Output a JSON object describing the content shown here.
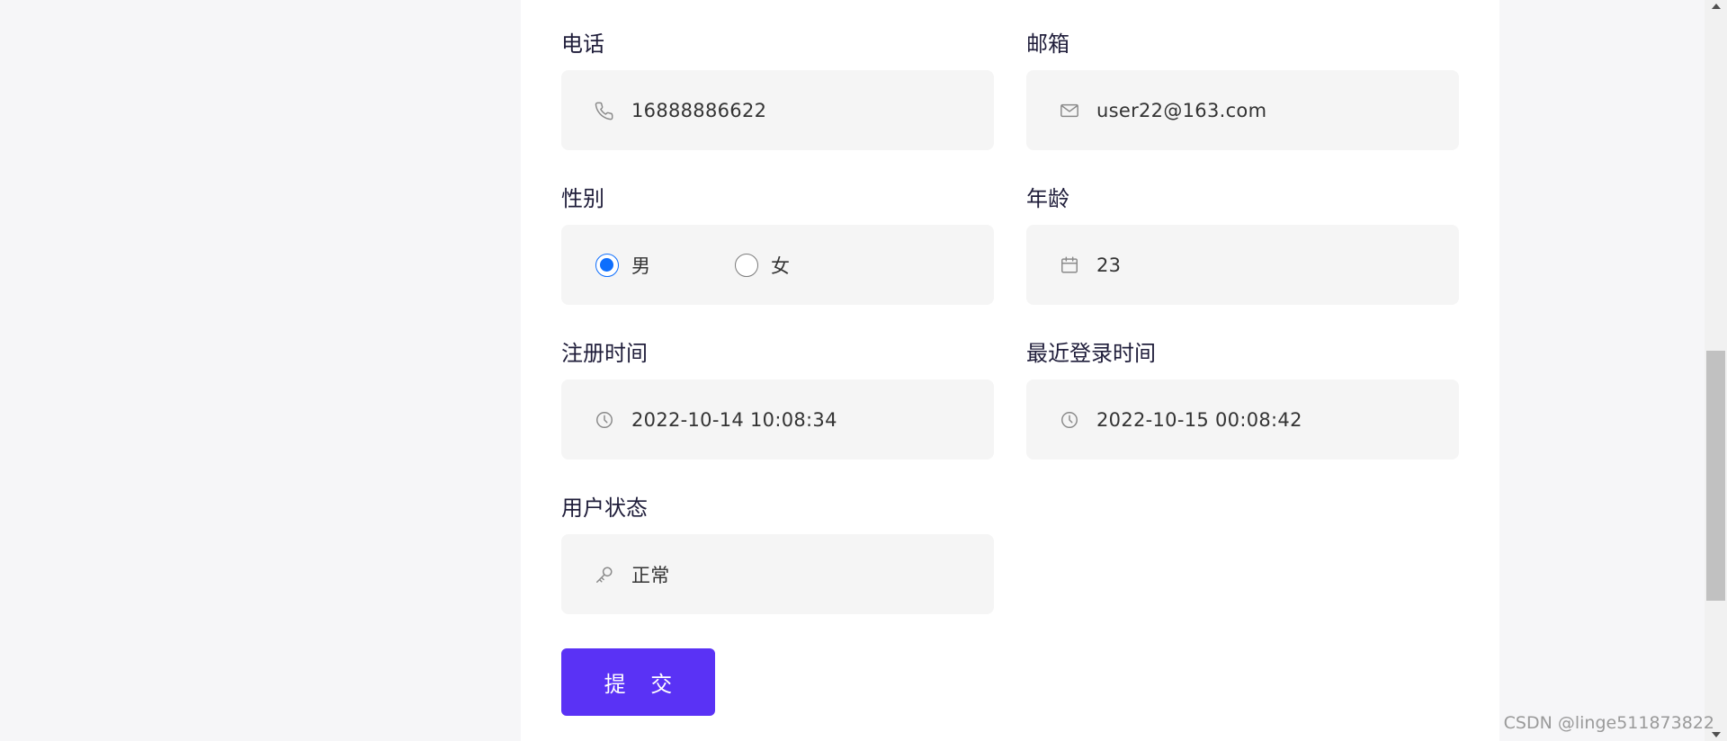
{
  "form": {
    "phone": {
      "label": "电话",
      "value": "16888886622",
      "icon": "phone-icon"
    },
    "email": {
      "label": "邮箱",
      "value": "user22@163.com",
      "icon": "mail-icon"
    },
    "gender": {
      "label": "性别",
      "options": [
        {
          "label": "男",
          "checked": true
        },
        {
          "label": "女",
          "checked": false
        }
      ]
    },
    "age": {
      "label": "年龄",
      "value": "23",
      "icon": "calendar-icon"
    },
    "register_time": {
      "label": "注册时间",
      "value": "2022-10-14 10:08:34",
      "icon": "clock-icon"
    },
    "last_login_time": {
      "label": "最近登录时间",
      "value": "2022-10-15 00:08:42",
      "icon": "clock-icon"
    },
    "user_status": {
      "label": "用户状态",
      "value": "正常",
      "icon": "key-icon"
    },
    "submit_label": "提 交"
  },
  "watermark": "CSDN @linge511873822",
  "colors": {
    "accent": "#5a32f5",
    "radio_checked": "#0d6efd",
    "field_bg": "#f5f5f5",
    "page_bg": "#f6f6f8"
  }
}
